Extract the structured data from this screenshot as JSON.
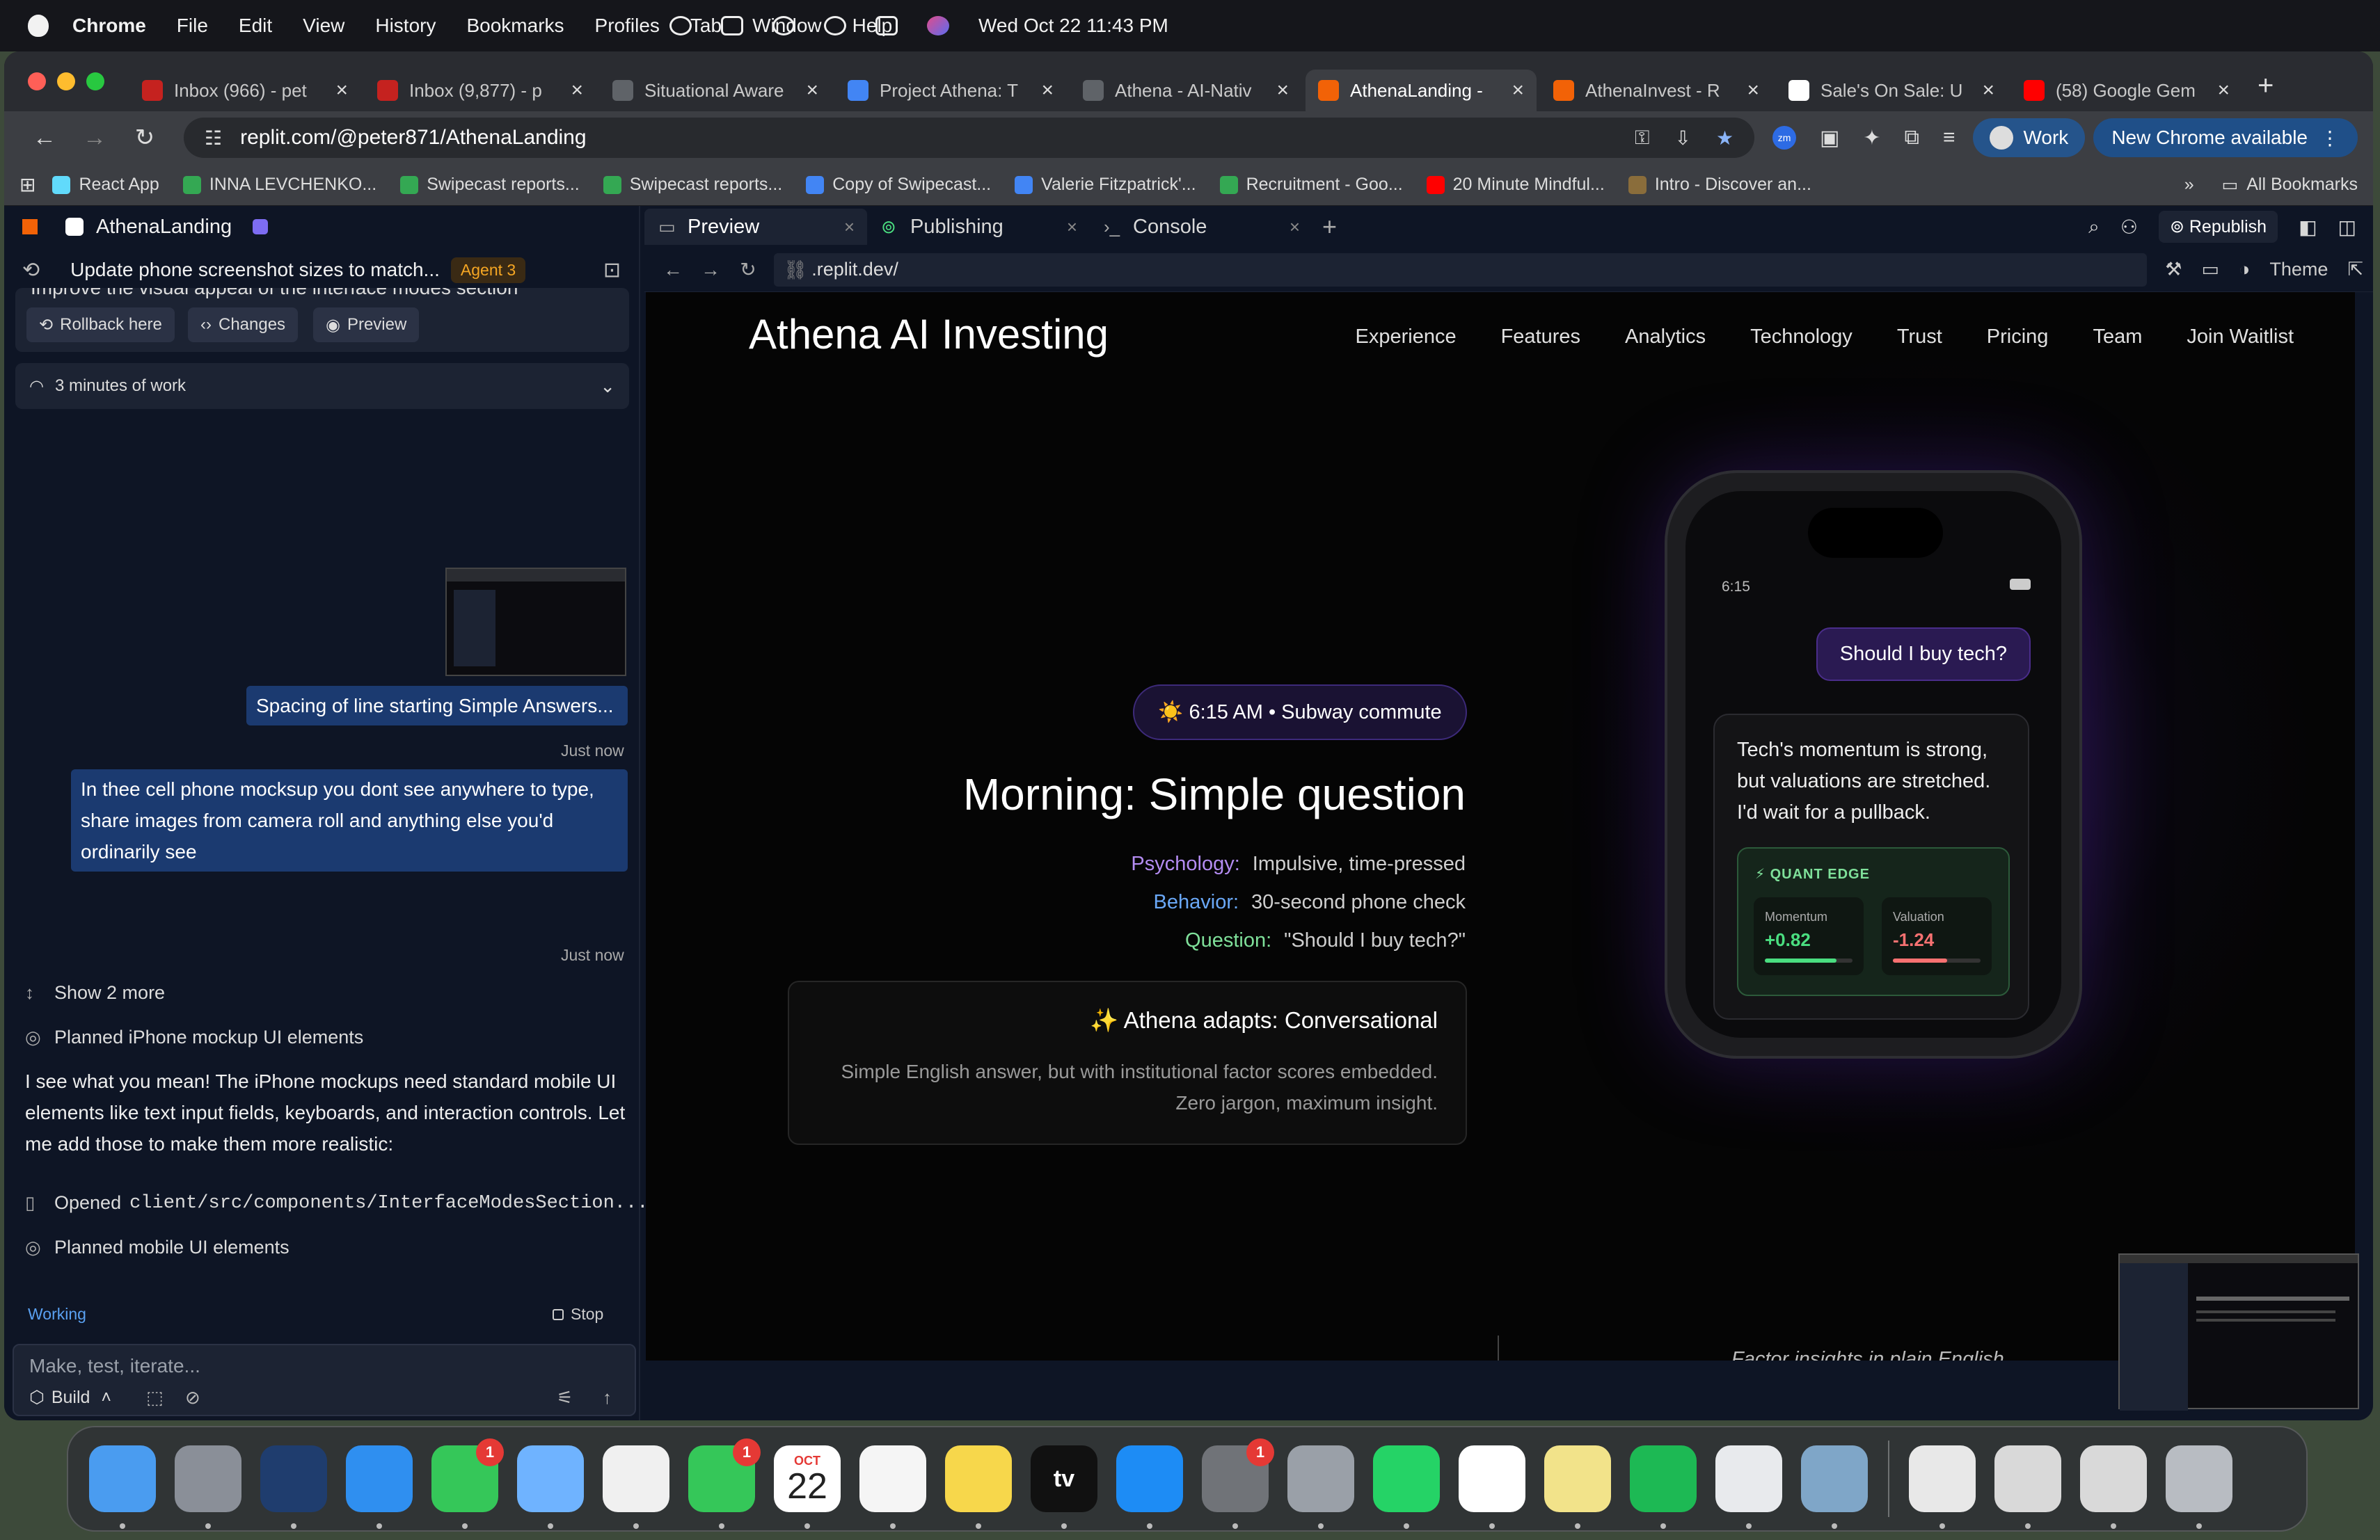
{
  "menubar": {
    "app": "Chrome",
    "items": [
      "File",
      "Edit",
      "View",
      "History",
      "Bookmarks",
      "Profiles",
      "Tab",
      "Window",
      "Help"
    ],
    "clock": "Wed Oct 22  11:43 PM"
  },
  "browser": {
    "tabs": [
      {
        "label": "Inbox (966) - pet",
        "icon": "gmail-icon",
        "color": "#c5221f"
      },
      {
        "label": "Inbox (9,877) - p",
        "icon": "gmail-icon",
        "color": "#c5221f"
      },
      {
        "label": "Situational Aware",
        "icon": "page-icon",
        "color": "#5f6368"
      },
      {
        "label": "Project Athena: T",
        "icon": "docs-icon",
        "color": "#4285f4"
      },
      {
        "label": "Athena - AI-Nativ",
        "icon": "globe-icon",
        "color": "#5f6368"
      },
      {
        "label": "AthenaLanding -",
        "icon": "replit-icon",
        "color": "#f26207",
        "active": true
      },
      {
        "label": "AthenaInvest - R",
        "icon": "replit-icon",
        "color": "#f26207"
      },
      {
        "label": "Sale's On Sale: U",
        "icon": "sale-icon",
        "color": "#ffffff"
      },
      {
        "label": "(58) Google Gem",
        "icon": "youtube-icon",
        "color": "#ff0000"
      }
    ],
    "url": "replit.com/@peter871/AthenaLanding",
    "work_label": "Work",
    "update_label": "New Chrome available",
    "bookmarks": [
      {
        "label": "React App",
        "color": "#61dafb"
      },
      {
        "label": "INNA LEVCHENKO...",
        "color": "#34a853"
      },
      {
        "label": "Swipecast reports...",
        "color": "#34a853"
      },
      {
        "label": "Swipecast reports...",
        "color": "#34a853"
      },
      {
        "label": "Copy of Swipecast...",
        "color": "#4285f4"
      },
      {
        "label": "Valerie Fitzpatrick'...",
        "color": "#4285f4"
      },
      {
        "label": "Recruitment - Goo...",
        "color": "#34a853"
      },
      {
        "label": "20 Minute Mindful...",
        "color": "#ff0000"
      },
      {
        "label": "Intro - Discover an...",
        "color": "#8a6d3b"
      }
    ],
    "all_bookmarks": "All Bookmarks"
  },
  "replit": {
    "project": "AthenaLanding",
    "task_title": "Update phone screenshot sizes to match...",
    "agent_badge": "Agent 3",
    "truncated_text": "Improve the visual appeal of the interface modes section",
    "pills": [
      "Rollback here",
      "Changes",
      "Preview"
    ],
    "work_summary": "3 minutes of work",
    "messages": [
      {
        "text": "Spacing of line starting Simple Answers...",
        "time": "Just now"
      },
      {
        "text": "In thee cell phone mocksup you dont see anywhere to type, share images from camera roll and anything else you'd ordinarily see",
        "time": "Just now"
      }
    ],
    "show_more": "Show 2 more",
    "planned_1": "Planned iPhone mockup UI elements",
    "response": "I see what you mean! The iPhone mockups need standard mobile UI elements like text input fields, keyboards, and interaction controls. Let me add those to make them more realistic:",
    "opened_prefix": "Opened",
    "opened_file": "client/src/components/InterfaceModesSection...",
    "planned_2": "Planned mobile UI elements",
    "status": "Working",
    "stop": "Stop",
    "input_placeholder": "Make, test, iterate...",
    "build": "Build"
  },
  "workspace": {
    "tabs": [
      "Preview",
      "Publishing",
      "Console"
    ],
    "republish": "Republish",
    "preview_url": ".replit.dev/",
    "theme": "Theme"
  },
  "site": {
    "brand": "Athena AI Investing",
    "nav": [
      "Experience",
      "Features",
      "Analytics",
      "Technology",
      "Trust",
      "Pricing",
      "Team",
      "Join Waitlist"
    ],
    "chip": "☀️ 6:15 AM • Subway commute",
    "heading": "Morning: Simple question",
    "meta": [
      {
        "key": "Psychology:",
        "value": "Impulsive, time-pressed",
        "color": "#b48cf2"
      },
      {
        "key": "Behavior:",
        "value": "30-second phone check",
        "color": "#6aa8f7"
      },
      {
        "key": "Question:",
        "value": "\"Should I buy tech?\"",
        "color": "#7fe09a"
      }
    ],
    "adapts_title": "✨ Athena adapts: Conversational",
    "adapts_desc": "Simple English answer, but with institutional factor scores embedded. Zero jargon, maximum insight.",
    "phone": {
      "time": "6:15",
      "question": "Should I buy tech?",
      "answer": "Tech's momentum is strong, but valuations are stretched. I'd wait for a pullback.",
      "edge_title": "⚡ QUANT EDGE",
      "metrics": [
        {
          "label": "Momentum",
          "value": "+0.82",
          "level": 0.82,
          "color": "#4ade80"
        },
        {
          "label": "Valuation",
          "value": "-1.24",
          "level": 0.62,
          "color": "#f87171"
        }
      ]
    },
    "footer_hint": "Factor insights in plain English"
  },
  "dock": {
    "apps": [
      {
        "name": "Finder",
        "icon": "finder-icon",
        "color": "#4a9cf0"
      },
      {
        "name": "Launchpad",
        "icon": "launchpad-icon",
        "color": "#8a8f98"
      },
      {
        "name": "Spark",
        "icon": "paper-plane-icon",
        "color": "#1f3d6e"
      },
      {
        "name": "Safari",
        "icon": "safari-icon",
        "color": "#2f8ff0"
      },
      {
        "name": "Messages",
        "icon": "messages-icon",
        "color": "#35c759",
        "badge": "1"
      },
      {
        "name": "Maps",
        "icon": "maps-icon",
        "color": "#6fb3ff"
      },
      {
        "name": "Photos",
        "icon": "photos-icon",
        "color": "#f0f0f0"
      },
      {
        "name": "FaceTime",
        "icon": "facetime-icon",
        "color": "#35c759",
        "badge": "1"
      },
      {
        "name": "Calendar",
        "icon": "calendar-icon",
        "month": "OCT",
        "day": "22"
      },
      {
        "name": "Reminders",
        "icon": "reminders-icon",
        "color": "#f5f5f5"
      },
      {
        "name": "Notes",
        "icon": "notes-icon",
        "color": "#f7d74b"
      },
      {
        "name": "TV",
        "icon": "tv-icon",
        "color": "#111111",
        "label": "tv"
      },
      {
        "name": "App Store",
        "icon": "app-store-icon",
        "color": "#1d8cf5"
      },
      {
        "name": "System Settings",
        "icon": "settings-icon",
        "color": "#707378",
        "badge": "1"
      },
      {
        "name": "iPhone Mirroring",
        "icon": "iphone-icon",
        "color": "#9aa0a8"
      },
      {
        "name": "WhatsApp",
        "icon": "whatsapp-icon",
        "color": "#25d366"
      },
      {
        "name": "Slack",
        "icon": "slack-icon",
        "color": "#ffffff"
      },
      {
        "name": "Stickies",
        "icon": "stickies-icon",
        "color": "#f2e38a"
      },
      {
        "name": "Spotify",
        "icon": "spotify-icon",
        "color": "#1db954"
      },
      {
        "name": "Chrome",
        "icon": "chrome-icon",
        "color": "#e8eaed"
      },
      {
        "name": "Preview",
        "icon": "preview-icon",
        "color": "#7fa6c8"
      }
    ],
    "stack": [
      {
        "name": "Document stack",
        "icon": "document-icon",
        "color": "#e8e8e8"
      },
      {
        "name": "Window preview",
        "icon": "window-icon",
        "color": "#d9d9d9"
      },
      {
        "name": "Window preview",
        "icon": "window-icon",
        "color": "#d9d9d9"
      },
      {
        "name": "Trash",
        "icon": "trash-icon",
        "color": "#b8bcc2"
      }
    ]
  }
}
